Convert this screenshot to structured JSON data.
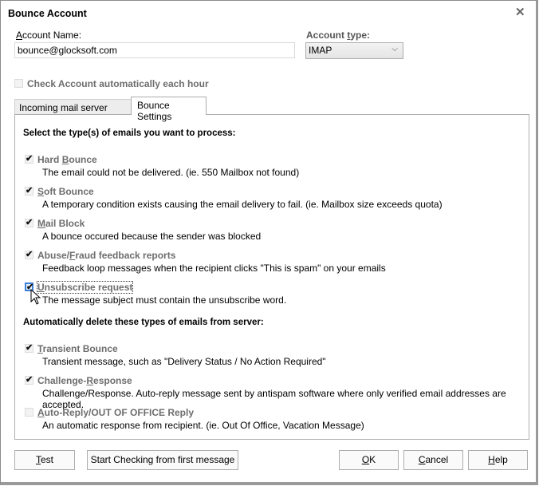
{
  "window": {
    "title": "Bounce Account",
    "close_icon": "close-icon"
  },
  "account": {
    "name_label_prefix": "",
    "name_label_mnemonic": "A",
    "name_label_rest": "ccount Name:",
    "name_value": "bounce@glocksoft.com",
    "type_label_prefix": "Account ",
    "type_label_mnemonic": "t",
    "type_label_rest": "ype:",
    "type_value": "IMAP"
  },
  "auto_check": {
    "label": "Check Account automatically each hour",
    "checked": false,
    "enabled": false
  },
  "tabs": [
    {
      "label": "Incoming mail server settings",
      "active": false
    },
    {
      "label": "Bounce Settings",
      "active": true
    }
  ],
  "process_section": {
    "title": "Select the type(s) of emails you want to process:",
    "items": [
      {
        "label_pre": "Hard ",
        "mnemonic": "B",
        "label_post": "ounce",
        "checked": true,
        "description": "The email could not be delivered. (ie. 550 Mailbox not found)"
      },
      {
        "label_pre": "",
        "mnemonic": "S",
        "label_post": "oft Bounce",
        "checked": true,
        "description": "A temporary condition exists causing the email delivery to fail. (ie. Mailbox size exceeds quota)"
      },
      {
        "label_pre": "",
        "mnemonic": "M",
        "label_post": "ail Block",
        "checked": true,
        "description": "A bounce occured because the sender was blocked"
      },
      {
        "label_pre": "Abuse/",
        "mnemonic": "F",
        "label_post": "raud feedback reports",
        "checked": true,
        "description": "Feedback loop messages when the recipient clicks \"This is spam\" on your emails"
      },
      {
        "label_pre": "",
        "mnemonic": "U",
        "label_post": "nsubscribe request",
        "checked": true,
        "focused": true,
        "description": "The message subject must contain the unsubscribe word."
      }
    ]
  },
  "delete_section": {
    "title": "Automatically delete these types of emails from server:",
    "items": [
      {
        "label_pre": "",
        "mnemonic": "T",
        "label_post": "ransient Bounce",
        "checked": true,
        "description": "Transient message, such as \"Delivery Status / No Action Required\""
      },
      {
        "label_pre": "Challenge-",
        "mnemonic": "R",
        "label_post": "esponse",
        "checked": true,
        "description": "Challenge/Response.  Auto-reply message sent by antispam software where only verified email addresses are accepted."
      },
      {
        "label_pre": "",
        "mnemonic": "A",
        "label_post": "uto-Reply/OUT OF OFFICE Reply",
        "checked": false,
        "description": "An automatic response from recipient. (ie. Out Of Office, Vacation Message)"
      }
    ]
  },
  "buttons": {
    "test": {
      "mnemonic": "T",
      "rest": "est"
    },
    "start_checking": {
      "label": "Start Checking from first message"
    },
    "ok": {
      "mnemonic": "O",
      "rest": "K"
    },
    "cancel": {
      "mnemonic": "C",
      "rest": "ancel"
    },
    "help": {
      "mnemonic": "H",
      "rest": "elp"
    }
  },
  "colors": {
    "focus_accent": "#3c7fd9",
    "disabled_label": "#6d6d6d"
  }
}
